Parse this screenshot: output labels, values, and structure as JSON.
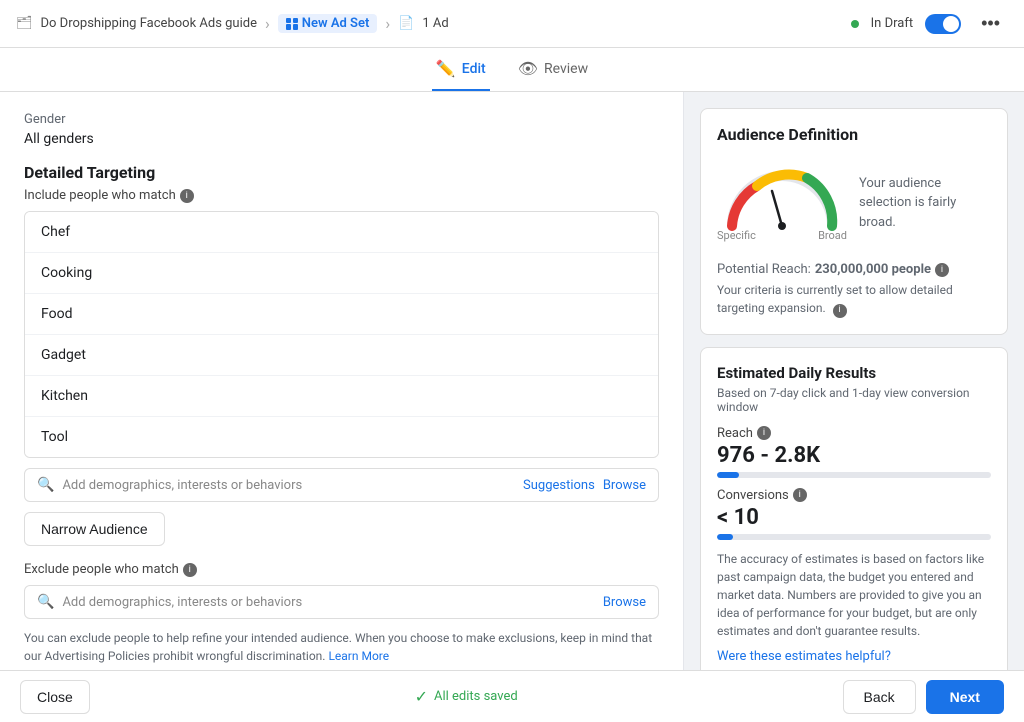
{
  "topbar": {
    "campaign_label": "Do Dropshipping Facebook Ads guide",
    "new_ad_set_label": "New Ad Set",
    "ad_label": "1 Ad",
    "status_label": "In Draft",
    "more_icon": "•••"
  },
  "tabs": {
    "edit_label": "Edit",
    "review_label": "Review"
  },
  "left": {
    "gender_title": "Gender",
    "gender_value": "All genders",
    "detailed_targeting_title": "Detailed Targeting",
    "include_label": "Include people who match",
    "targeting_items": [
      "Chef",
      "Cooking",
      "Food",
      "Gadget",
      "Kitchen",
      "Tool"
    ],
    "search_placeholder": "Add demographics, interests or behaviors",
    "suggestions_label": "Suggestions",
    "browse_label": "Browse",
    "narrow_btn_label": "Narrow Audience",
    "exclude_label": "Exclude people who match",
    "exclude_search_placeholder": "Add demographics, interests or behaviors",
    "exclude_browse_label": "Browse",
    "note_text": "You can exclude people to help refine your intended audience. When you choose to make exclusions, keep in mind that our Advertising Policies prohibit wrongful discrimination.",
    "learn_more_label": "Learn More"
  },
  "right": {
    "audience_def_title": "Audience Definition",
    "gauge_label_specific": "Specific",
    "gauge_label_broad": "Broad",
    "audience_note": "Your audience selection is fairly broad.",
    "potential_reach_label": "Potential Reach:",
    "potential_reach_value": "230,000,000 people",
    "reach_note": "Your criteria is currently set to allow detailed targeting expansion.",
    "est_title": "Estimated Daily Results",
    "est_subtitle": "Based on 7-day click and 1-day view conversion window",
    "reach_metric_label": "Reach",
    "reach_metric_value": "976 - 2.8K",
    "reach_fill_percent": 8,
    "conversions_label": "Conversions",
    "conversions_value": "< 10",
    "conversions_fill_percent": 6,
    "est_note": "The accuracy of estimates is based on factors like past campaign data, the budget you entered and market data. Numbers are provided to give you an idea of performance for your budget, but are only estimates and don't guarantee results.",
    "helpful_label": "Were these estimates helpful?"
  },
  "bottom": {
    "close_label": "Close",
    "saved_label": "All edits saved",
    "back_label": "Back",
    "next_label": "Next"
  }
}
